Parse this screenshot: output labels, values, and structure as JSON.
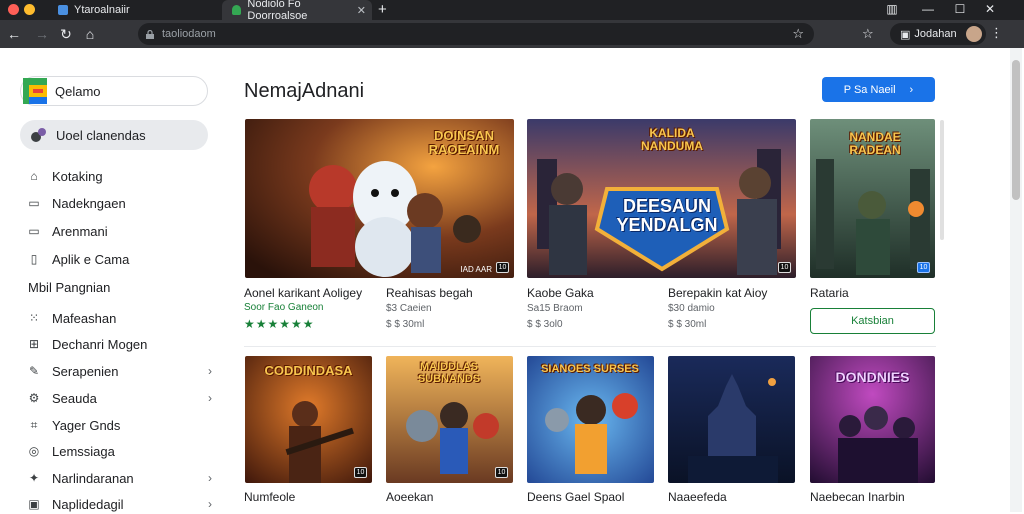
{
  "browser": {
    "inactive_tab": "Ytaroalnaiir",
    "active_tab": "Nodiolo Fo Doorroalsoe",
    "address": "taoliodaom",
    "profile_name": "Jodahan",
    "colors": {
      "tabbar": "#202124",
      "toolbar": "#35363a",
      "accent": "#1a73e8",
      "green": "#188038"
    }
  },
  "sidebar": {
    "logo_text": "Qelamo",
    "active_item": "Uoel clanendas",
    "items": [
      {
        "label": "Kotaking",
        "icon": "home-icon"
      },
      {
        "label": "Nadekngaen",
        "icon": "book-icon"
      },
      {
        "label": "Arenmani",
        "icon": "tv-icon"
      },
      {
        "label": "Aplik e Cama",
        "icon": "phone-icon"
      }
    ],
    "section_heading": "Mbil Pangnian",
    "section_items": [
      {
        "label": "Mafeashan",
        "icon": "grid-icon",
        "chevron": false
      },
      {
        "label": "Dechanri Mogen",
        "icon": "apps-icon",
        "chevron": false
      },
      {
        "label": "Serapenien",
        "icon": "pencil-icon",
        "chevron": true
      },
      {
        "label": "Seauda",
        "icon": "settings-icon",
        "chevron": true
      },
      {
        "label": "Yager Gnds",
        "icon": "tag-icon",
        "chevron": false
      },
      {
        "label": "Lemssiaga",
        "icon": "compass-icon",
        "chevron": false
      },
      {
        "label": "Narlindaranan",
        "icon": "puzzle-icon",
        "chevron": true
      },
      {
        "label": "Naplidedagil",
        "icon": "monitor-icon",
        "chevron": true
      }
    ]
  },
  "main": {
    "title": "NemajAdnani",
    "more_button": "P Sa Naeil",
    "row1": [
      {
        "title": "Aonel karikant Aoligey",
        "sub1": "Soor Fao Ganeon",
        "sub2": "",
        "art_text": "DOINSAN RAOEAINM",
        "corner": "IAD AAR",
        "badge": "10"
      },
      {
        "title": "Reahisas begah",
        "sub1": "$3 Caeien",
        "sub2": "$ $ 30ml",
        "art_text": "",
        "corner": "",
        "badge": "10"
      },
      {
        "title": "Kaobe Gaka",
        "sub1": "Sa15 Braom",
        "sub2": "$ $ 3ol0",
        "art_text": "KALIDA NANDUMA",
        "corner": "",
        "badge": ""
      },
      {
        "title": "Berepakin kat Aioy",
        "sub1": "$30 damio",
        "sub2": "$ $ 30ml",
        "art_text": "DEESAUN YENDALGN",
        "corner": "",
        "badge": "10"
      },
      {
        "title": "Rataria",
        "sub1": "",
        "sub2": "",
        "art_text": "NANDAE RADEAN",
        "corner": "",
        "badge": "10"
      }
    ],
    "stars": "★★★★★★",
    "install_button": "Katsbian",
    "row2": [
      {
        "title": "Numfeole",
        "art_text": "CODDINDASA",
        "badge": "10"
      },
      {
        "title": "Aoeekan",
        "art_text": "MAIDDLAS SUBNANDS",
        "badge": "10"
      },
      {
        "title": "Deens Gael Spaol",
        "art_text": "SIANOES SURSES",
        "badge": ""
      },
      {
        "title": "Naaeefeda",
        "art_text": "",
        "badge": ""
      },
      {
        "title": "Naebecan Inarbin",
        "art_text": "DONDNIES",
        "badge": ""
      }
    ]
  }
}
